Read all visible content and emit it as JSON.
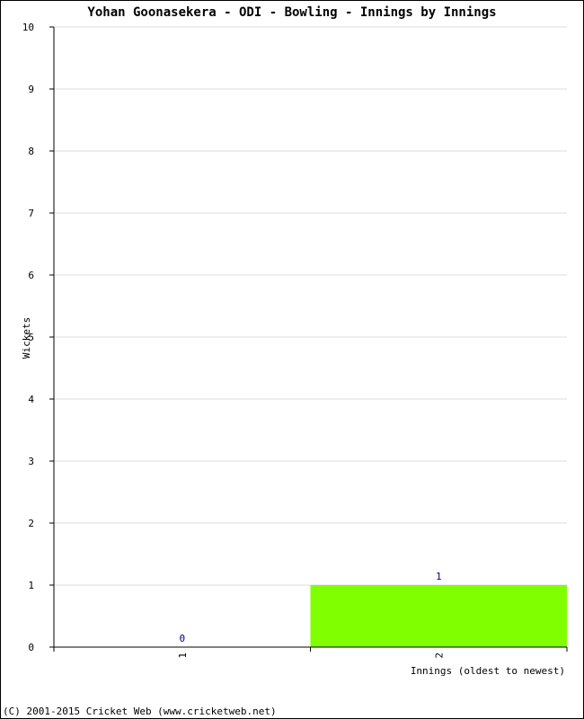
{
  "chart_data": {
    "type": "bar",
    "title": "Yohan Goonasekera - ODI - Bowling - Innings by Innings",
    "xlabel": "Innings (oldest to newest)",
    "ylabel": "Wickets",
    "categories": [
      "1",
      "2"
    ],
    "values": [
      0,
      1
    ],
    "data_labels": [
      "0",
      "1"
    ],
    "ylim": [
      0,
      10
    ],
    "yticks": [
      0,
      1,
      2,
      3,
      4,
      5,
      6,
      7,
      8,
      9,
      10
    ],
    "grid": true,
    "legend": "none",
    "bar_color": "#80ff00",
    "label_color": "#000080"
  },
  "footer": "(C) 2001-2015 Cricket Web (www.cricketweb.net)"
}
